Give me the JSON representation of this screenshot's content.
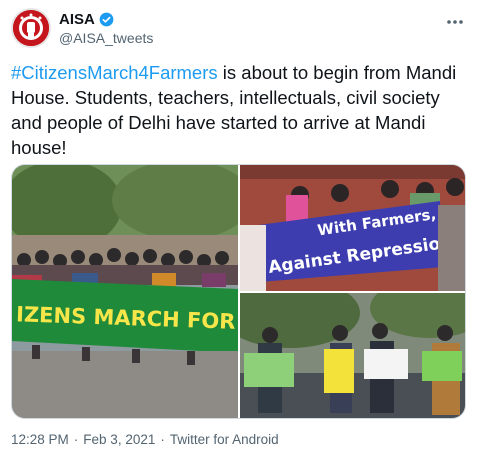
{
  "account": {
    "name": "AISA",
    "handle": "@AISA_tweets",
    "verified": true,
    "brand_color": "#c4161c"
  },
  "tweet": {
    "hashtag": "#CitizensMarch4Farmers",
    "text": " is about to begin from Mandi House. Students, teachers, intellectuals, civil society and people of Delhi have started to arrive at Mandi house!",
    "link_color": "#1d9bf0"
  },
  "media": {
    "banner_left": "IZENS MARCH FOR FARMERS",
    "banner_right_line1": "With Farmers,",
    "banner_right_line2": "Against Repression"
  },
  "meta": {
    "time": "12:28 PM",
    "date": "Feb 3, 2021",
    "separator": "·",
    "source": "Twitter for Android"
  },
  "icons": [
    "verified-badge-icon",
    "more-options-icon"
  ]
}
